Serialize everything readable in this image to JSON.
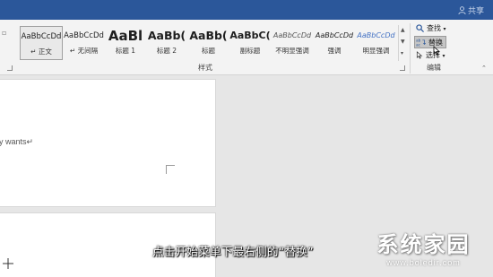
{
  "title_bar": {
    "share_label": "共享",
    "share_icon": "person-icon"
  },
  "styles_group": {
    "label": "样式",
    "tiles": [
      {
        "sample": "AaBbCcDd",
        "name": "↵ 正文"
      },
      {
        "sample": "AaBbCcDd",
        "name": "↵ 无间隔"
      },
      {
        "sample": "AaBl",
        "name": "标题 1"
      },
      {
        "sample": "AaBb(",
        "name": "标题 2"
      },
      {
        "sample": "AaBb(",
        "name": "标题"
      },
      {
        "sample": "AaBbC(",
        "name": "副标题"
      },
      {
        "sample": "AaBbCcDd",
        "name": "不明显强调"
      },
      {
        "sample": "AaBbCcDd",
        "name": "强调"
      },
      {
        "sample": "AaBbCcDd",
        "name": "明显强调"
      }
    ]
  },
  "edit_group": {
    "label": "编辑",
    "find_label": "查找",
    "replace_label": "替换",
    "select_label": "选择"
  },
  "document": {
    "page1_text": "y wants↵"
  },
  "caption": {
    "text": "点击开始菜单下最右侧的“替换”"
  },
  "watermark": {
    "title": "系统家园",
    "url": "www.boledir.com"
  }
}
